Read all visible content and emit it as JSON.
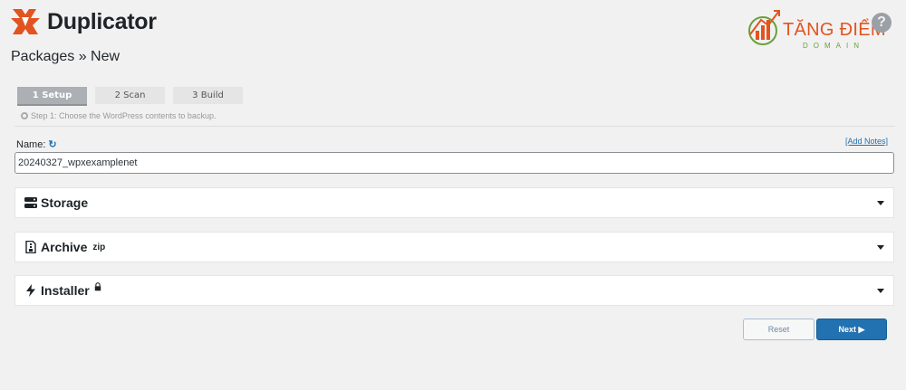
{
  "brand": {
    "name": "Duplicator",
    "accent_color": "#e2541f"
  },
  "page": {
    "title": "Packages » New"
  },
  "watermark": {
    "title": "TĂNG ĐIỂM",
    "subtitle": "DOMAIN"
  },
  "help": {
    "icon": "question-circle-icon",
    "glyph": "?"
  },
  "steps": [
    {
      "label": "1 Setup",
      "active": true
    },
    {
      "label": "2 Scan",
      "active": false
    },
    {
      "label": "3 Build",
      "active": false
    }
  ],
  "step_hint": "Step 1: Choose the WordPress contents to backup.",
  "name_field": {
    "label": "Name:",
    "value": "20240327_wpxexamplenet",
    "add_notes_link": "[Add Notes]"
  },
  "panels": [
    {
      "label": "Storage",
      "icon": "storage-icon",
      "sup": ""
    },
    {
      "label": "Archive",
      "icon": "archive-file-icon",
      "sup": "zip"
    },
    {
      "label": "Installer",
      "icon": "bolt-icon",
      "sup": "🔒"
    }
  ],
  "buttons": {
    "reset": "Reset",
    "next": "Next ▶"
  },
  "colors": {
    "primary_button": "#2271b1",
    "background": "#f1f1f1"
  }
}
